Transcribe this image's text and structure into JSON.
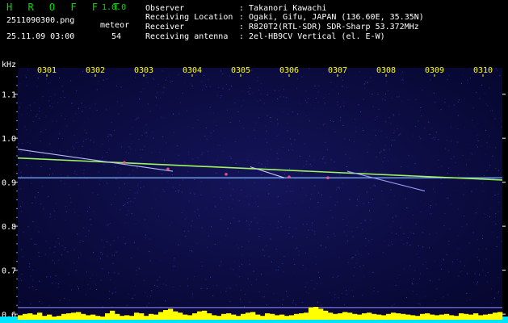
{
  "header": {
    "app_name": "H R O F F T",
    "app_version": "1.0.0",
    "file_name": "2511090300.png",
    "meteor_label": "meteor",
    "datetime": "25.11.09 03:00",
    "meteor_count": "54",
    "info": [
      {
        "key": "Observer",
        "value": ": Takanori Kawachi"
      },
      {
        "key": "Receiving Location",
        "value": ": Ogaki, Gifu, JAPAN (136.60E, 35.35N)"
      },
      {
        "key": "Receiver",
        "value": ": R820T2(RTL-SDR) SDR-Sharp 53.372MHz"
      },
      {
        "key": "Receiving antenna",
        "value": ": 2el-HB9CV Vertical (el. E-W)"
      }
    ]
  },
  "colors": {
    "app_text": "#00e000",
    "background": "#000000",
    "spectrogram_bg": "#0a0a44",
    "time_labels": "#ffff00",
    "baseline": "#00e5ff",
    "signal_bars": "#ffff00"
  },
  "chart_data": {
    "type": "heatmap",
    "ylabel": "kHz",
    "time_ticks": [
      "0301",
      "0302",
      "0303",
      "0304",
      "0305",
      "0306",
      "0307",
      "0308",
      "0309",
      "0310"
    ],
    "y_ticks": [
      "1.1",
      "1.0",
      "0.9",
      "0.8",
      "0.7",
      "0.6"
    ],
    "ylim": [
      0.58,
      1.16
    ],
    "xlim_min": [
      0,
      10
    ],
    "carrier_khz": 0.91,
    "meteor_trails": [
      {
        "start_min": 0.0,
        "start_khz": 0.955,
        "end_min": 10.0,
        "end_khz": 0.905
      },
      {
        "start_min": 0.0,
        "start_khz": 0.975,
        "end_min": 3.2,
        "end_khz": 0.925
      },
      {
        "start_min": 6.8,
        "start_khz": 0.925,
        "end_min": 8.4,
        "end_khz": 0.88
      },
      {
        "start_min": 4.8,
        "start_khz": 0.935,
        "end_min": 5.5,
        "end_khz": 0.91
      }
    ],
    "signal_strength": [
      0.35,
      0.45,
      0.5,
      0.4,
      0.55,
      0.3,
      0.4,
      0.25,
      0.3,
      0.45,
      0.5,
      0.55,
      0.6,
      0.45,
      0.35,
      0.4,
      0.3,
      0.25,
      0.5,
      0.7,
      0.45,
      0.3,
      0.35,
      0.3,
      0.55,
      0.5,
      0.3,
      0.45,
      0.4,
      0.6,
      0.75,
      0.85,
      0.65,
      0.55,
      0.4,
      0.35,
      0.5,
      0.65,
      0.7,
      0.5,
      0.35,
      0.3,
      0.45,
      0.5,
      0.4,
      0.3,
      0.45,
      0.55,
      0.6,
      0.4,
      0.3,
      0.5,
      0.45,
      0.35,
      0.4,
      0.3,
      0.35,
      0.45,
      0.5,
      0.55,
      0.95,
      1.0,
      0.85,
      0.7,
      0.55,
      0.45,
      0.5,
      0.6,
      0.55,
      0.45,
      0.4,
      0.5,
      0.55,
      0.45,
      0.4,
      0.35,
      0.45,
      0.55,
      0.5,
      0.45,
      0.4,
      0.35,
      0.3,
      0.45,
      0.5,
      0.4,
      0.35,
      0.4,
      0.45,
      0.35,
      0.3,
      0.5,
      0.45,
      0.4,
      0.5,
      0.35,
      0.4,
      0.45,
      0.55,
      0.6
    ]
  }
}
